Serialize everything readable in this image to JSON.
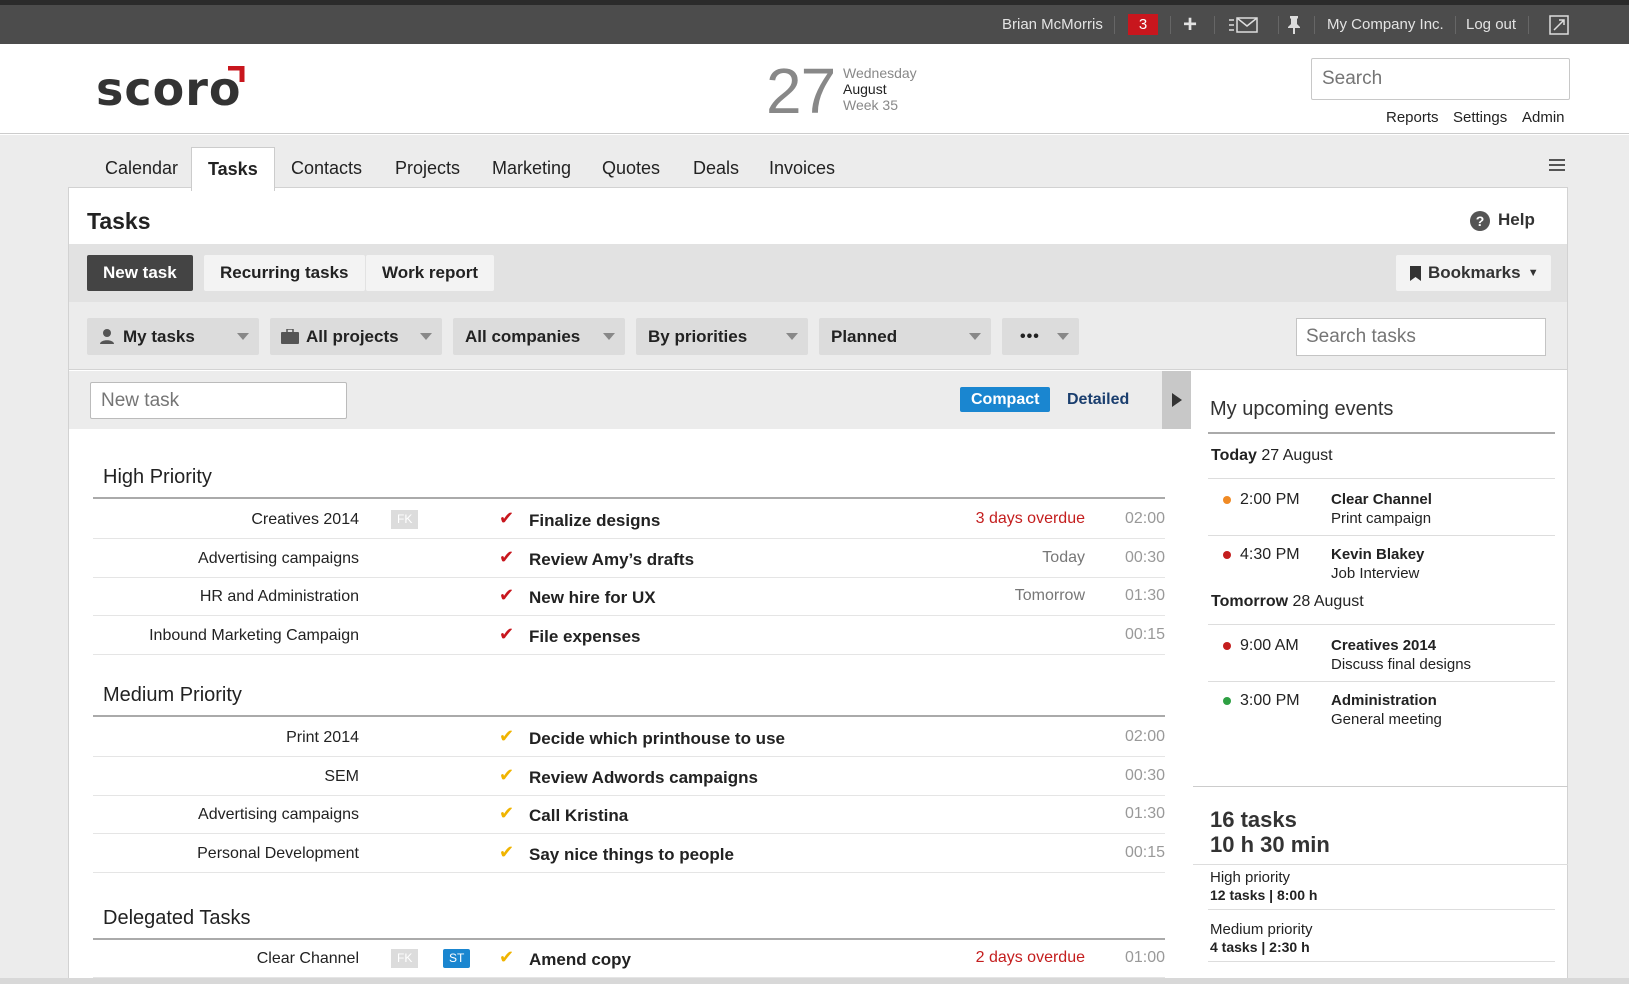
{
  "topbar": {
    "user": "Brian McMorris",
    "notifications": "3",
    "company": "My Company Inc.",
    "logout": "Log out"
  },
  "header": {
    "logo": "scoro",
    "date_day": "27",
    "weekday": "Wednesday",
    "month": "August",
    "week": "Week 35",
    "search_placeholder": "Search",
    "links": [
      "Reports",
      "Settings",
      "Admin"
    ]
  },
  "nav": {
    "tabs": [
      "Calendar",
      "Tasks",
      "Contacts",
      "Projects",
      "Marketing",
      "Quotes",
      "Deals",
      "Invoices"
    ],
    "active": "Tasks"
  },
  "page": {
    "title": "Tasks",
    "help": "Help",
    "buttons": {
      "new_task": "New task",
      "recurring": "Recurring tasks",
      "work_report": "Work report",
      "bookmarks": "Bookmarks"
    },
    "filters": [
      "My tasks",
      "All projects",
      "All companies",
      "By priorities",
      "Planned",
      "•••"
    ],
    "search_tasks_placeholder": "Search tasks",
    "new_task_placeholder": "New task",
    "view_compact": "Compact",
    "view_detailed": "Detailed"
  },
  "groups": [
    {
      "title": "High Priority",
      "tasks": [
        {
          "project": "Creatives 2014",
          "tags": [
            "FK"
          ],
          "name": "Finalize designs",
          "when": "3 days overdue",
          "overdue": true,
          "duration": "02:00"
        },
        {
          "project": "Advertising campaigns",
          "tags": [],
          "name": "Review Amy’s drafts",
          "when": "Today",
          "overdue": false,
          "duration": "00:30"
        },
        {
          "project": "HR and Administration",
          "tags": [],
          "name": "New hire for UX",
          "when": "Tomorrow",
          "overdue": false,
          "duration": "01:30"
        },
        {
          "project": "Inbound Marketing Campaign",
          "tags": [],
          "name": "File expenses",
          "when": "",
          "overdue": false,
          "duration": "00:15"
        }
      ]
    },
    {
      "title": "Medium Priority",
      "tasks": [
        {
          "project": "Print 2014",
          "tags": [],
          "name": "Decide which printhouse to use",
          "when": "",
          "overdue": false,
          "duration": "02:00"
        },
        {
          "project": "SEM",
          "tags": [],
          "name": "Review Adwords campaigns",
          "when": "",
          "overdue": false,
          "duration": "00:30"
        },
        {
          "project": "Advertising campaigns",
          "tags": [],
          "name": "Call Kristina",
          "when": "",
          "overdue": false,
          "duration": "01:30"
        },
        {
          "project": "Personal Development",
          "tags": [],
          "name": "Say nice things to people",
          "when": "",
          "overdue": false,
          "duration": "00:15"
        }
      ]
    },
    {
      "title": "Delegated Tasks",
      "tasks": [
        {
          "project": "Clear Channel",
          "tags": [
            "FK",
            "ST"
          ],
          "name": "Amend copy",
          "when": "2 days overdue",
          "overdue": true,
          "duration": "01:00"
        }
      ]
    }
  ],
  "sidebar": {
    "title": "My upcoming events",
    "days": [
      {
        "label": "Today",
        "date": "27 August",
        "events": [
          {
            "time": "2:00 PM",
            "title": "Clear Channel",
            "sub": "Print campaign",
            "color": "#f08a24"
          },
          {
            "time": "4:30 PM",
            "title": "Kevin Blakey",
            "sub": "Job Interview",
            "color": "#c41e1e"
          }
        ]
      },
      {
        "label": "Tomorrow",
        "date": "28 August",
        "events": [
          {
            "time": "9:00 AM",
            "title": "Creatives 2014",
            "sub": "Discuss final designs",
            "color": "#c41e1e"
          },
          {
            "time": "3:00 PM",
            "title": "Administration",
            "sub": "General meeting",
            "color": "#2ea043"
          }
        ]
      }
    ],
    "summary": {
      "tasks": "16 tasks",
      "time": "10 h 30 min",
      "high_label": "High priority",
      "high_value": "12 tasks | 8:00 h",
      "medium_label": "Medium priority",
      "medium_value": "4 tasks | 2:30 h"
    }
  },
  "colors": {
    "accent": "#1a86d0",
    "brand_red": "#c8161d",
    "overdue": "#c41e1e",
    "high_check": "#c8161d",
    "medium_check": "#f0b400"
  }
}
